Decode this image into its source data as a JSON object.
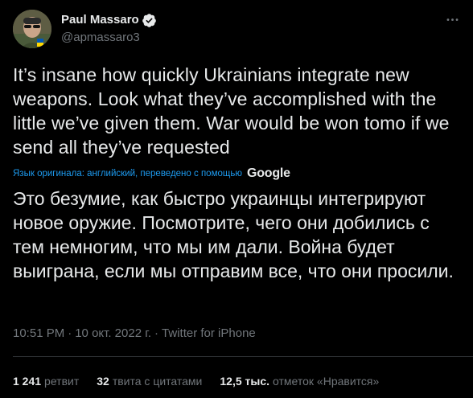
{
  "author": {
    "display_name": "Paul Massaro",
    "handle": "@apmassaro3",
    "verified": true
  },
  "tweet": {
    "original_text": "It’s insane how quickly Ukrainians integrate new weapons. Look what they’ve accomplished with the little we’ve given them. War would be won tomo if we send all they’ve requested",
    "translation_label": "Язык оригинала: английский, переведено с помощью",
    "translation_provider": "Google",
    "translated_text": "Это безумие, как быстро украинцы интегрируют новое оружие. Посмотрите, чего они добились с тем немногим, что мы им дали. Война будет выиграна, если мы отправим все, что они просили."
  },
  "meta": {
    "time": "10:51 PM",
    "separator": "·",
    "date": "10 окт. 2022 г.",
    "source": "Twitter for iPhone"
  },
  "stats": {
    "retweets_count": "1 241",
    "retweets_label": "ретвит",
    "quotes_count": "32",
    "quotes_label": "твита с цитатами",
    "likes_count": "12,5 тыс.",
    "likes_label": "отметок «Нравится»"
  },
  "colors": {
    "background": "#000000",
    "text_primary": "#e7e9ea",
    "text_secondary": "#71767b",
    "accent": "#1d9bf0",
    "divider": "#2f3336"
  },
  "icons": {
    "verified": "verified-badge-icon",
    "more": "more-options-icon"
  }
}
